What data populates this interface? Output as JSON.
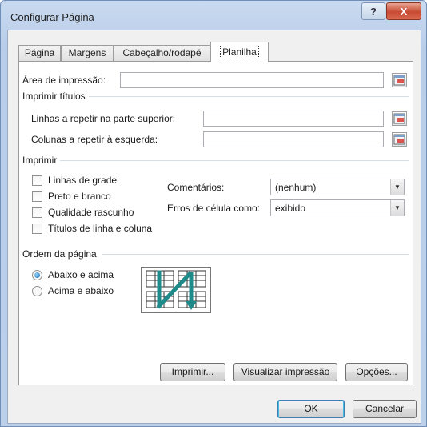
{
  "window": {
    "title": "Configurar Página",
    "help_glyph": "?",
    "close_glyph": "X"
  },
  "tabs": [
    {
      "label": "Página"
    },
    {
      "label": "Margens"
    },
    {
      "label": "Cabeçalho/rodapé"
    },
    {
      "label": "Planilha",
      "active": true
    }
  ],
  "print_area": {
    "label": "Área de impressão:",
    "value": ""
  },
  "print_titles": {
    "group_label": "Imprimir títulos",
    "rows_label": "Linhas a repetir na parte superior:",
    "rows_value": "",
    "cols_label": "Colunas a repetir à esquerda:",
    "cols_value": ""
  },
  "print": {
    "group_label": "Imprimir",
    "gridlines": {
      "label": "Linhas de grade",
      "checked": false
    },
    "black_white": {
      "label": "Preto e branco",
      "checked": false
    },
    "draft": {
      "label": "Qualidade rascunho",
      "checked": false
    },
    "headings": {
      "label": "Títulos de linha e coluna",
      "checked": false
    },
    "comments_label": "Comentários:",
    "comments_value": "(nenhum)",
    "errors_label": "Erros de célula como:",
    "errors_value": "exibido"
  },
  "page_order": {
    "group_label": "Ordem da página",
    "down_then_over": "Abaixo e acima",
    "over_then_down": "Acima e abaixo",
    "selected": "down_then_over"
  },
  "buttons": {
    "print": "Imprimir...",
    "preview": "Visualizar impressão",
    "options": "Opções...",
    "ok": "OK",
    "cancel": "Cancelar"
  },
  "colors": {
    "accent": "#1d6fb5",
    "arrow": "#1f8a8a",
    "titlebar": "#bcd0ea"
  },
  "icons": [
    "help-icon",
    "close-icon",
    "range-picker-icon",
    "dropdown-arrow-icon",
    "page-order-icon"
  ]
}
